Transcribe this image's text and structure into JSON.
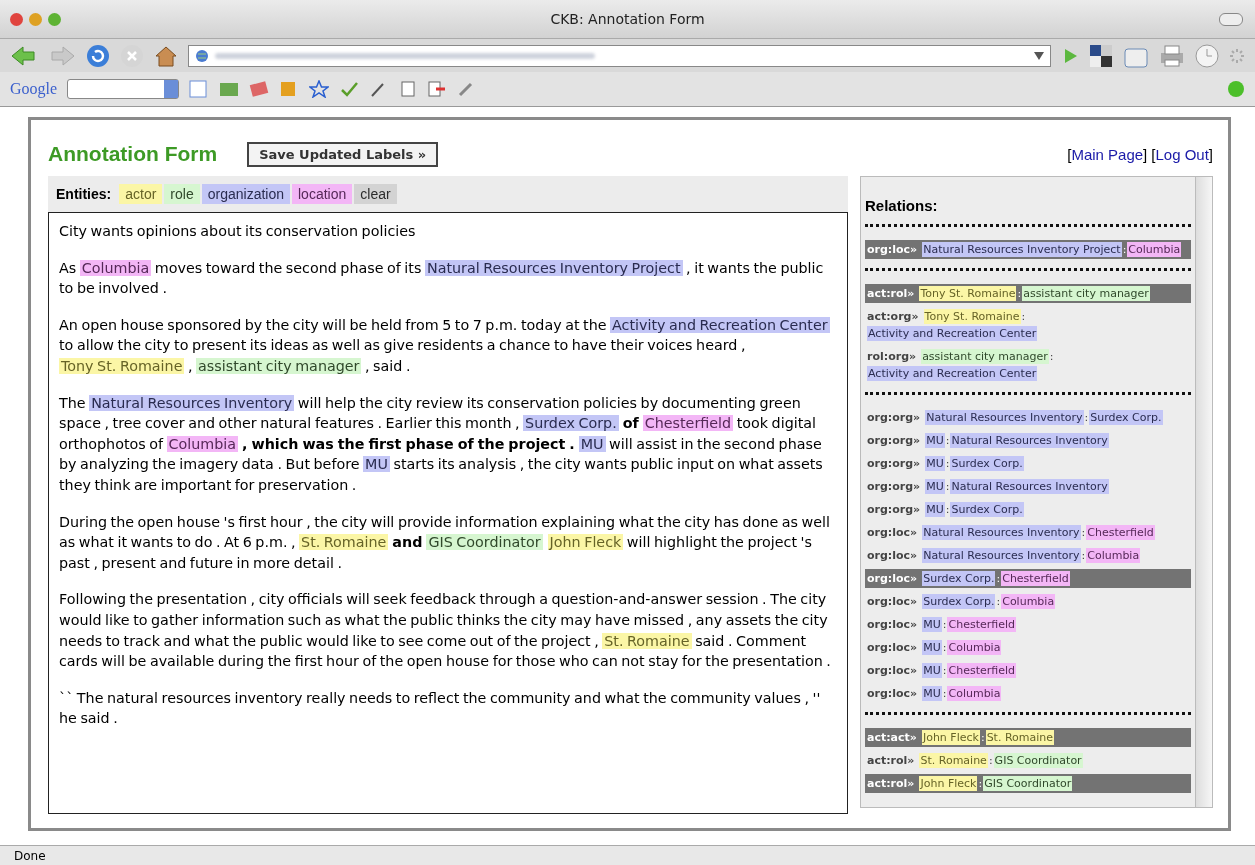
{
  "window": {
    "title": "CKB: Annotation Form"
  },
  "google_toolbar": {
    "logo": "Google"
  },
  "page": {
    "title": "Annotation Form",
    "save_button": "Save Updated Labels »",
    "links": [
      {
        "open": "[",
        "label": "Main Page",
        "close": "]"
      },
      {
        "open": "[",
        "label": "Log Out",
        "close": "]"
      }
    ]
  },
  "entities": {
    "label": "Entities:",
    "buttons": [
      {
        "label": "actor",
        "color": "#fbf6a6"
      },
      {
        "label": "role",
        "color": "#d6f6d0"
      },
      {
        "label": "organization",
        "color": "#c3c6f6"
      },
      {
        "label": "location",
        "color": "#f3b6f6"
      },
      {
        "label": "clear",
        "color": "#d3d3d3"
      }
    ]
  },
  "document": [
    [
      {
        "kind": "text",
        "t": "City wants opinions about its conservation policies"
      }
    ],
    [
      {
        "kind": "text",
        "t": "As "
      },
      {
        "kind": "entity",
        "color": "#f3b6f6",
        "t": "Columbia"
      },
      {
        "kind": "text",
        "t": " moves toward the second phase of its "
      },
      {
        "kind": "entity",
        "color": "#c3c6f6",
        "t": "Natural Resources Inventory Project"
      },
      {
        "kind": "text",
        "t": " , it wants the public to be involved ."
      }
    ],
    [
      {
        "kind": "text",
        "t": "An open house sponsored by the city will be held from 5 to 7 p.m. today at the "
      },
      {
        "kind": "entity",
        "color": "#c3c6f6",
        "t": "Activity and Recreation Center"
      },
      {
        "kind": "text",
        "t": " to allow the city to present its ideas as well as give residents a chance to have their voices heard , "
      },
      {
        "kind": "entity",
        "color": "#fbf6a6",
        "t": "Tony St. Romaine"
      },
      {
        "kind": "text",
        "t": " , "
      },
      {
        "kind": "entity",
        "color": "#d6f6d0",
        "t": "assistant city manager"
      },
      {
        "kind": "text",
        "t": " , said ."
      }
    ],
    [
      {
        "kind": "text",
        "t": "The "
      },
      {
        "kind": "entity",
        "color": "#c3c6f6",
        "t": "Natural Resources Inventory"
      },
      {
        "kind": "text",
        "t": " will help the city review its conservation policies by documenting green space , tree cover and other natural features .   Earlier this month , "
      },
      {
        "kind": "entity",
        "color": "#c3c6f6",
        "t": "Surdex Corp."
      },
      {
        "kind": "bold",
        "t": " of "
      },
      {
        "kind": "entity",
        "color": "#f3b6f6",
        "t": "Chesterfield"
      },
      {
        "kind": "text",
        "t": " took digital orthophotos of "
      },
      {
        "kind": "entity",
        "color": "#f3b6f6",
        "t": "Columbia"
      },
      {
        "kind": "bold",
        "t": " , which was the first phase of the project .   "
      },
      {
        "kind": "entity",
        "color": "#c3c6f6",
        "t": "MU"
      },
      {
        "kind": "text",
        "t": " will assist in the second phase by analyzing the imagery data .   But before "
      },
      {
        "kind": "entity",
        "color": "#c3c6f6",
        "t": "MU"
      },
      {
        "kind": "text",
        "t": " starts its analysis , the city wants public input on what assets they think are important for preservation ."
      }
    ],
    [
      {
        "kind": "text",
        "t": "During the open house 's first hour , the city will provide information explaining what the city has done as well as what it wants to do .   At 6 p.m. , "
      },
      {
        "kind": "entity",
        "color": "#fbf6a6",
        "t": "St. Romaine"
      },
      {
        "kind": "bold",
        "t": " and "
      },
      {
        "kind": "entity",
        "color": "#d6f6d0",
        "t": "GIS Coordinator"
      },
      {
        "kind": "entity",
        "color": "#fbf6a6",
        "t": "John Fleck"
      },
      {
        "kind": "text",
        "t": " will highlight the project 's past , present and future in more detail ."
      }
    ],
    [
      {
        "kind": "text",
        "t": "Following the presentation , city officials will seek feedback through a question-and-answer session .   The city would like to gather information such as what the public thinks the city may have missed , any assets the city needs to track and what the public would like to see come out of the project , "
      },
      {
        "kind": "entity",
        "color": "#fbf6a6",
        "t": "St. Romaine"
      },
      {
        "kind": "text",
        "t": " said . Comment cards will be available during the first hour of the open house for those who can not stay for the presentation ."
      }
    ],
    [
      {
        "kind": "text",
        "t": "`` The natural resources inventory really needs to reflect the community and what the community values , '' he said ."
      }
    ]
  ],
  "relations": {
    "title": "Relations:",
    "groups": [
      [
        {
          "label": "org:loc»",
          "a": {
            "text": "Natural Resources Inventory Project",
            "color": "#c3c6f6"
          },
          "sep": ":",
          "b": {
            "text": "Columbia",
            "color": "#f3b6f6"
          },
          "selected": true
        }
      ],
      [
        {
          "label": "act:rol»",
          "a": {
            "text": "Tony St. Romaine",
            "color": "#fbf6a6"
          },
          "sep": ":",
          "b": {
            "text": "assistant city manager",
            "color": "#d6f6d0"
          },
          "selected": true
        },
        {
          "label": "act:org»",
          "a": {
            "text": "Tony St. Romaine",
            "color": "#fbf6a6"
          },
          "sep": ":",
          "b": {
            "text": "Activity and Recreation Center",
            "color": "#c3c6f6"
          },
          "selected": false
        },
        {
          "label": "rol:org»",
          "a": {
            "text": "assistant city manager",
            "color": "#d6f6d0"
          },
          "sep": ":",
          "b": {
            "text": "Activity and Recreation Center",
            "color": "#c3c6f6"
          },
          "selected": false
        }
      ],
      [
        {
          "label": "org:org»",
          "a": {
            "text": "Natural Resources Inventory",
            "color": "#c3c6f6"
          },
          "sep": ":",
          "b": {
            "text": "Surdex Corp.",
            "color": "#c3c6f6"
          },
          "selected": false
        },
        {
          "label": "org:org»",
          "a": {
            "text": "MU",
            "color": "#c3c6f6"
          },
          "sep": ":",
          "b": {
            "text": "Natural Resources Inventory",
            "color": "#c3c6f6"
          },
          "selected": false
        },
        {
          "label": "org:org»",
          "a": {
            "text": "MU",
            "color": "#c3c6f6"
          },
          "sep": ":",
          "b": {
            "text": "Surdex Corp.",
            "color": "#c3c6f6"
          },
          "selected": false
        },
        {
          "label": "org:org»",
          "a": {
            "text": "MU",
            "color": "#c3c6f6"
          },
          "sep": ":",
          "b": {
            "text": "Natural Resources Inventory",
            "color": "#c3c6f6"
          },
          "selected": false
        },
        {
          "label": "org:org»",
          "a": {
            "text": "MU",
            "color": "#c3c6f6"
          },
          "sep": ":",
          "b": {
            "text": "Surdex Corp.",
            "color": "#c3c6f6"
          },
          "selected": false
        },
        {
          "label": "org:loc»",
          "a": {
            "text": "Natural Resources Inventory",
            "color": "#c3c6f6"
          },
          "sep": ":",
          "b": {
            "text": "Chesterfield",
            "color": "#f3b6f6"
          },
          "selected": false
        },
        {
          "label": "org:loc»",
          "a": {
            "text": "Natural Resources Inventory",
            "color": "#c3c6f6"
          },
          "sep": ":",
          "b": {
            "text": "Columbia",
            "color": "#f3b6f6"
          },
          "selected": false
        },
        {
          "label": "org:loc»",
          "a": {
            "text": "Surdex Corp.",
            "color": "#c3c6f6"
          },
          "sep": ":",
          "b": {
            "text": "Chesterfield",
            "color": "#f3b6f6"
          },
          "selected": true
        },
        {
          "label": "org:loc»",
          "a": {
            "text": "Surdex Corp.",
            "color": "#c3c6f6"
          },
          "sep": ":",
          "b": {
            "text": "Columbia",
            "color": "#f3b6f6"
          },
          "selected": false
        },
        {
          "label": "org:loc»",
          "a": {
            "text": "MU",
            "color": "#c3c6f6"
          },
          "sep": ":",
          "b": {
            "text": "Chesterfield",
            "color": "#f3b6f6"
          },
          "selected": false
        },
        {
          "label": "org:loc»",
          "a": {
            "text": "MU",
            "color": "#c3c6f6"
          },
          "sep": ":",
          "b": {
            "text": "Columbia",
            "color": "#f3b6f6"
          },
          "selected": false
        },
        {
          "label": "org:loc»",
          "a": {
            "text": "MU",
            "color": "#c3c6f6"
          },
          "sep": ":",
          "b": {
            "text": "Chesterfield",
            "color": "#f3b6f6"
          },
          "selected": false
        },
        {
          "label": "org:loc»",
          "a": {
            "text": "MU",
            "color": "#c3c6f6"
          },
          "sep": ":",
          "b": {
            "text": "Columbia",
            "color": "#f3b6f6"
          },
          "selected": false
        }
      ],
      [
        {
          "label": "act:act»",
          "a": {
            "text": "John Fleck",
            "color": "#fbf6a6"
          },
          "sep": ":",
          "b": {
            "text": "St. Romaine",
            "color": "#fbf6a6"
          },
          "selected": true
        },
        {
          "label": "act:rol»",
          "a": {
            "text": "St. Romaine",
            "color": "#fbf6a6"
          },
          "sep": ":",
          "b": {
            "text": "GIS Coordinator",
            "color": "#d6f6d0"
          },
          "selected": false
        },
        {
          "label": "act:rol»",
          "a": {
            "text": "John Fleck",
            "color": "#fbf6a6"
          },
          "sep": ":",
          "b": {
            "text": "GIS Coordinator",
            "color": "#d6f6d0"
          },
          "selected": true
        }
      ]
    ]
  },
  "status_bar": {
    "text": "Done"
  }
}
